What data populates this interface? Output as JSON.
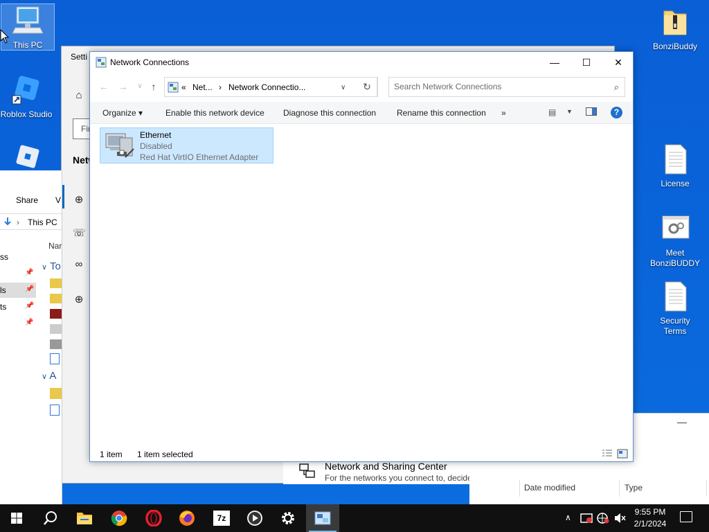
{
  "desktop": {
    "icons": [
      {
        "label": "This PC",
        "icon": "computer-icon"
      },
      {
        "label": "Roblox Studio",
        "icon": "roblox-studio-icon"
      },
      {
        "label": "BonziBuddy",
        "icon": "zip-folder-icon"
      },
      {
        "label": "License",
        "icon": "text-document-icon"
      },
      {
        "label": "Meet BonziBUDDY",
        "icon": "settings-file-icon"
      },
      {
        "label": "Security Terms",
        "icon": "text-document-icon"
      }
    ]
  },
  "background_explorer": {
    "share_tab": "Share",
    "view_tab_partial": "V",
    "address": "This PC",
    "nav_fragments": [
      "ss",
      "ls",
      "ts"
    ],
    "col_name_partial": "Nar",
    "group_quick_partial": "To",
    "group_recent_partial": "A"
  },
  "settings": {
    "title_partial": "Setti",
    "find_partial": "Fin",
    "section_partial": "Netw",
    "card_title": "Network and Sharing Center",
    "card_subtitle": "For the networks you connect to, decide what you want to share."
  },
  "explorer_right": {
    "columns": [
      "Date modified",
      "Type"
    ],
    "min_label": "—"
  },
  "net_window": {
    "title": "Network Connections",
    "breadcrumb": [
      "Net...",
      "Network Connectio..."
    ],
    "breadcrumb_prefix": "«",
    "search_placeholder": "Search Network Connections",
    "commands": [
      "Organize ▾",
      "Enable this network device",
      "Diagnose this connection",
      "Rename this connection",
      "»"
    ],
    "help_label": "?",
    "item": {
      "name": "Ethernet",
      "status": "Disabled",
      "adapter": "Red Hat VirtIO Ethernet Adapter"
    },
    "status": {
      "count": "1 item",
      "selected": "1 item selected"
    }
  },
  "taskbar": {
    "apps": [
      "start-button",
      "search-button",
      "file-explorer",
      "chrome",
      "opera",
      "firefox",
      "7zip",
      "media-player",
      "settings",
      "network-connections"
    ],
    "clock_time": "9:55 PM",
    "clock_date": "2/1/2024"
  },
  "colors": {
    "accent": "#0067c0",
    "selection": "#cce8ff",
    "desktop": "#0a63d9",
    "taskbar": "#101010"
  }
}
